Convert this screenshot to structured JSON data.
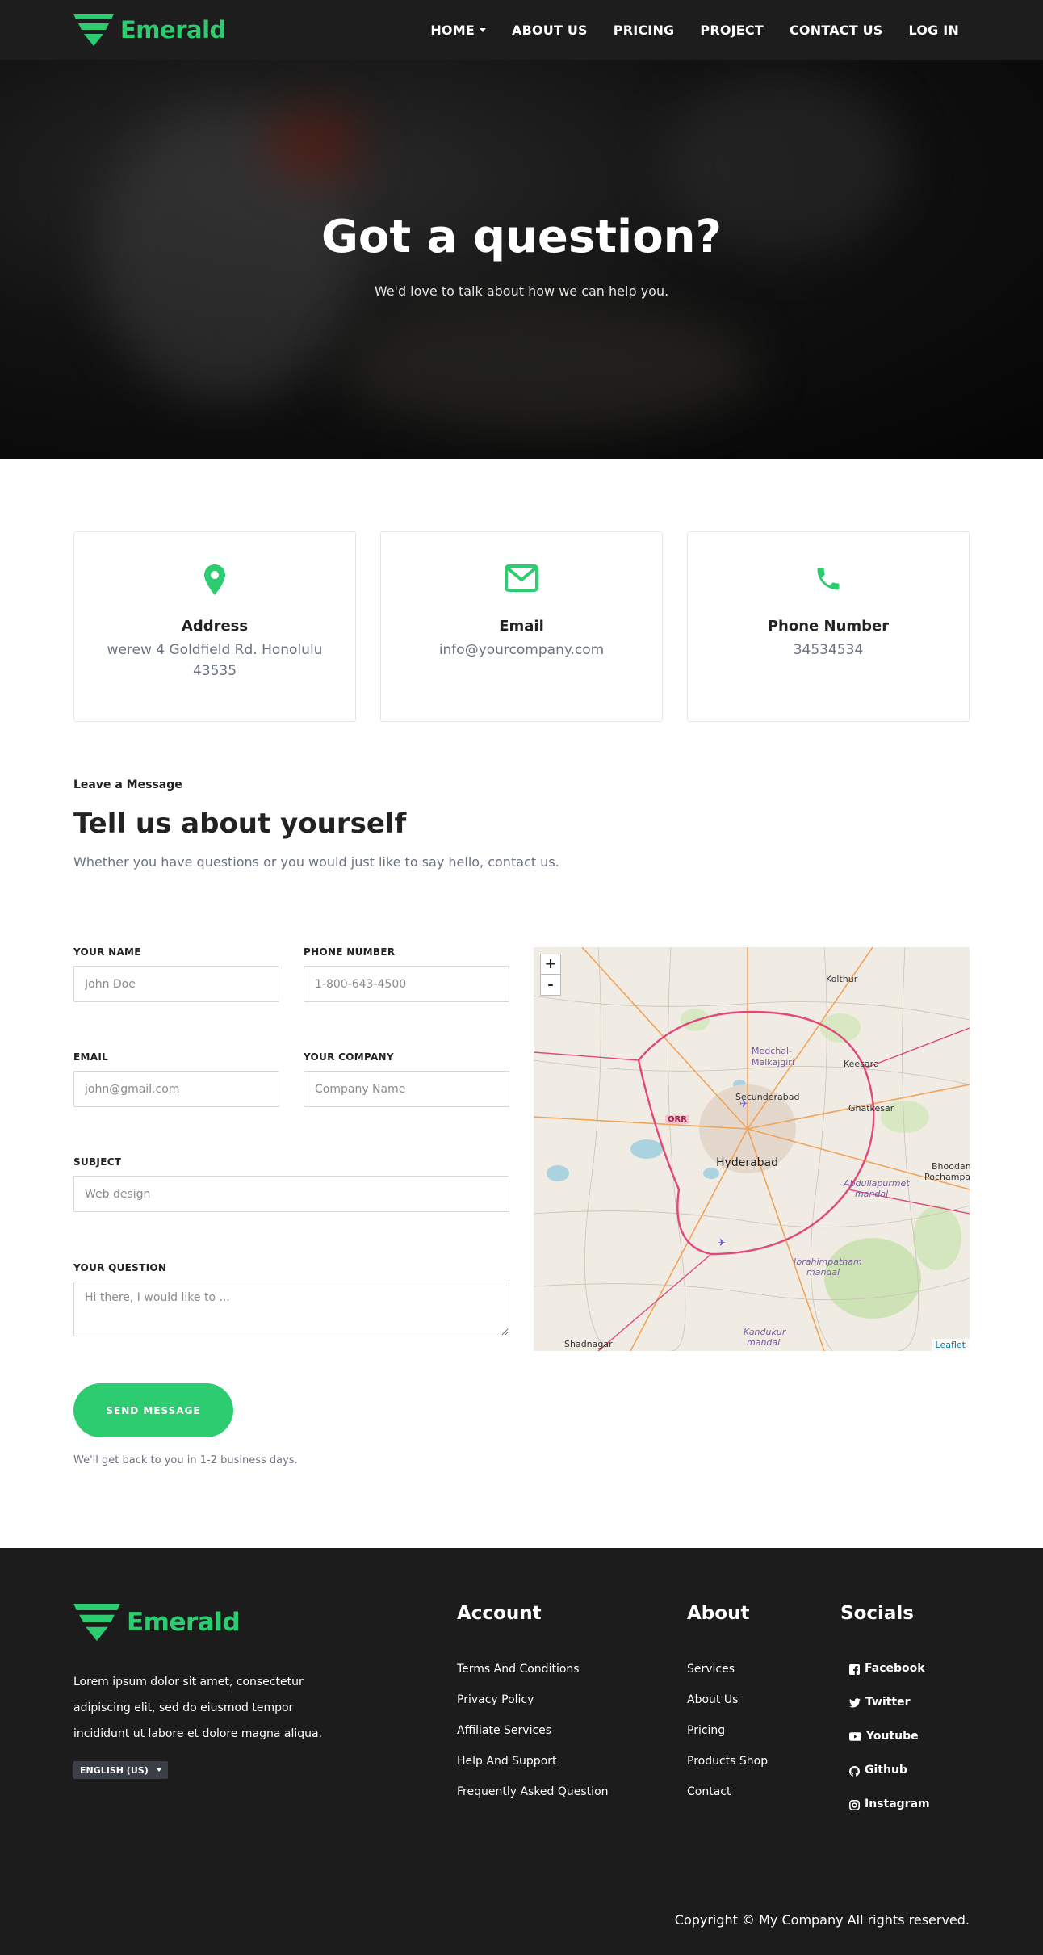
{
  "brand": {
    "name": "Emerald",
    "color": "#2ecc71"
  },
  "nav": {
    "items": [
      {
        "label": "HOME",
        "has_dropdown": true
      },
      {
        "label": "ABOUT US"
      },
      {
        "label": "PRICING"
      },
      {
        "label": "PROJECT"
      },
      {
        "label": "CONTACT US"
      },
      {
        "label": "LOG IN"
      }
    ]
  },
  "hero": {
    "title": "Got a question?",
    "subtitle": "We'd love to talk about how we can help you."
  },
  "cards": [
    {
      "icon": "map-pin-icon",
      "title": "Address",
      "text": "werew 4 Goldfield Rd. Honolulu 43535"
    },
    {
      "icon": "envelope-icon",
      "title": "Email",
      "text": "info@yourcompany.com"
    },
    {
      "icon": "phone-icon",
      "title": "Phone Number",
      "text": "34534534"
    }
  ],
  "message": {
    "eyebrow": "Leave a Message",
    "title_bold": "Tell us about",
    "title_rest": " yourself",
    "subtitle": "Whether you have questions or you would just like to say hello, contact us."
  },
  "form": {
    "name": {
      "label": "YOUR NAME",
      "placeholder": "John Doe"
    },
    "phone": {
      "label": "PHONE NUMBER",
      "placeholder": "1-800-643-4500"
    },
    "email": {
      "label": "EMAIL",
      "placeholder": "john@gmail.com"
    },
    "company": {
      "label": "YOUR COMPANY",
      "placeholder": "Company Name"
    },
    "subject": {
      "label": "SUBJECT",
      "placeholder": "Web design"
    },
    "question": {
      "label": "YOUR QUESTION",
      "placeholder": "Hi there, I would like to ..."
    },
    "submit": "SEND MESSAGE",
    "note": "We'll get back to you in 1-2 business days."
  },
  "map": {
    "zoom_in": "+",
    "zoom_out": "-",
    "attribution": "Leaflet",
    "labels": {
      "kolthur": "Kolthur",
      "medchal": "Medchal-",
      "malkajgiri": "Malkajgiri",
      "keesara": "Keesara",
      "secunderabad": "Secunderabad",
      "ghatkesar": "Ghatkesar",
      "orr": "ORR",
      "hyderabad": "Hyderabad",
      "bhoodan": "Bhoodan",
      "pochampalli": "Pochampalli",
      "abdullapurmet": "Abdullapurmet",
      "mandal": "mandal",
      "ibrahimpatnam": "Ibrahimpatnam",
      "mandal2": "mandal",
      "kandukur": "Kandukur",
      "mandal3": "mandal",
      "shadnagar": "Shadnagar"
    }
  },
  "footer": {
    "about": "Lorem ipsum dolor sit amet, consectetur adipiscing elit, sed do eiusmod tempor incididunt ut labore et dolore magna aliqua.",
    "language": "ENGLISH (US)",
    "account": {
      "heading": "Account",
      "links": [
        "Terms And Conditions",
        "Privacy Policy",
        "Affiliate Services",
        "Help And Support",
        "Frequently Asked Question"
      ]
    },
    "about_col": {
      "heading": "About",
      "links": [
        "Services",
        "About Us",
        "Pricing",
        "Products Shop",
        "Contact"
      ]
    },
    "socials": {
      "heading": "Socials",
      "links": [
        {
          "label": "Facebook",
          "icon": "facebook-icon"
        },
        {
          "label": "Twitter",
          "icon": "twitter-icon"
        },
        {
          "label": "Youtube",
          "icon": "youtube-icon"
        },
        {
          "label": "Github",
          "icon": "github-icon"
        },
        {
          "label": "Instagram",
          "icon": "instagram-icon"
        }
      ]
    },
    "copyright": "Copyright © My Company All rights reserved."
  }
}
